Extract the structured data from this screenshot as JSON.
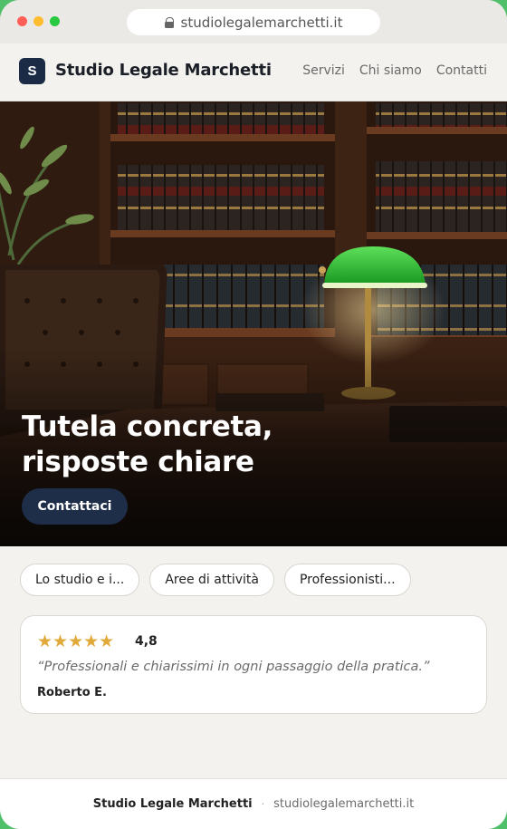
{
  "browser": {
    "url": "studiolegalemarchetti.it"
  },
  "header": {
    "logo_letter": "S",
    "brand": "Studio Legale Marchetti",
    "nav": [
      "Servizi",
      "Chi siamo",
      "Contatti"
    ]
  },
  "hero": {
    "title": "Tutela concreta, risposte chiare",
    "cta": "Contattaci"
  },
  "chips": [
    "Lo studio e i...",
    "Aree di attività",
    "Professionisti..."
  ],
  "review": {
    "stars": "★★★★★",
    "rating": "4,8",
    "quote": "“Professionali e chiarissimi in ogni passaggio della pratica.”",
    "author": "Roberto E."
  },
  "footer": {
    "brand": "Studio Legale Marchetti",
    "separator": "·",
    "domain": "studiolegalemarchetti.it"
  },
  "colors": {
    "brand_navy": "#1e2d48",
    "star_gold": "#e0a93a",
    "page_background": "#f4f2ee"
  }
}
